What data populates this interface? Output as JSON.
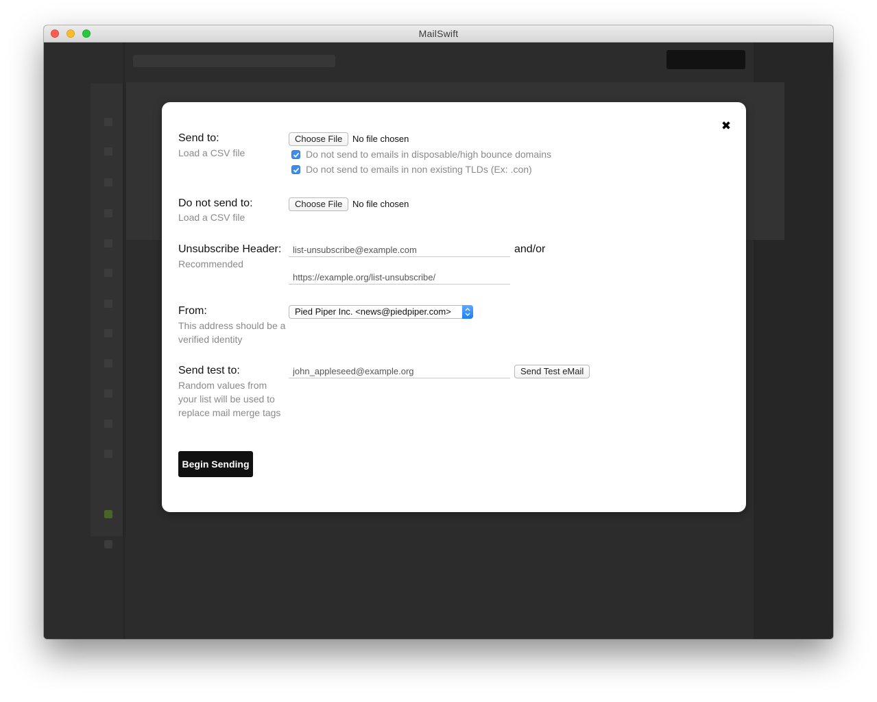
{
  "window": {
    "title": "MailSwift"
  },
  "modal": {
    "send_to": {
      "label": "Send to:",
      "sub": "Load a CSV file",
      "file_button": "Choose File",
      "file_status": "No file chosen",
      "checkboxes": [
        {
          "label": "Do not send to emails in disposable/high bounce domains",
          "checked": true
        },
        {
          "label": "Do not send to emails in non existing TLDs (Ex: .con)",
          "checked": true
        }
      ]
    },
    "do_not_send": {
      "label": "Do not send to:",
      "sub": "Load a CSV file",
      "file_button": "Choose File",
      "file_status": "No file chosen"
    },
    "unsubscribe": {
      "label": "Unsubscribe Header:",
      "sub": "Recommended",
      "email_value": "list-unsubscribe@example.com",
      "andor": "and/or",
      "url_value": "https://example.org/list-unsubscribe/"
    },
    "from": {
      "label": "From:",
      "sub": "This address should be a verified identity",
      "selected": "Pied Piper Inc. <news@piedpiper.com>"
    },
    "send_test": {
      "label": "Send test to:",
      "sub": "Random values from your list will be used to replace mail merge tags",
      "email_value": "john_appleseed@example.org",
      "button": "Send Test eMail"
    },
    "begin_button": "Begin Sending",
    "close_icon": "close-icon"
  },
  "colors": {
    "accent": "#3b8ef0",
    "primary_button": "#111111"
  }
}
